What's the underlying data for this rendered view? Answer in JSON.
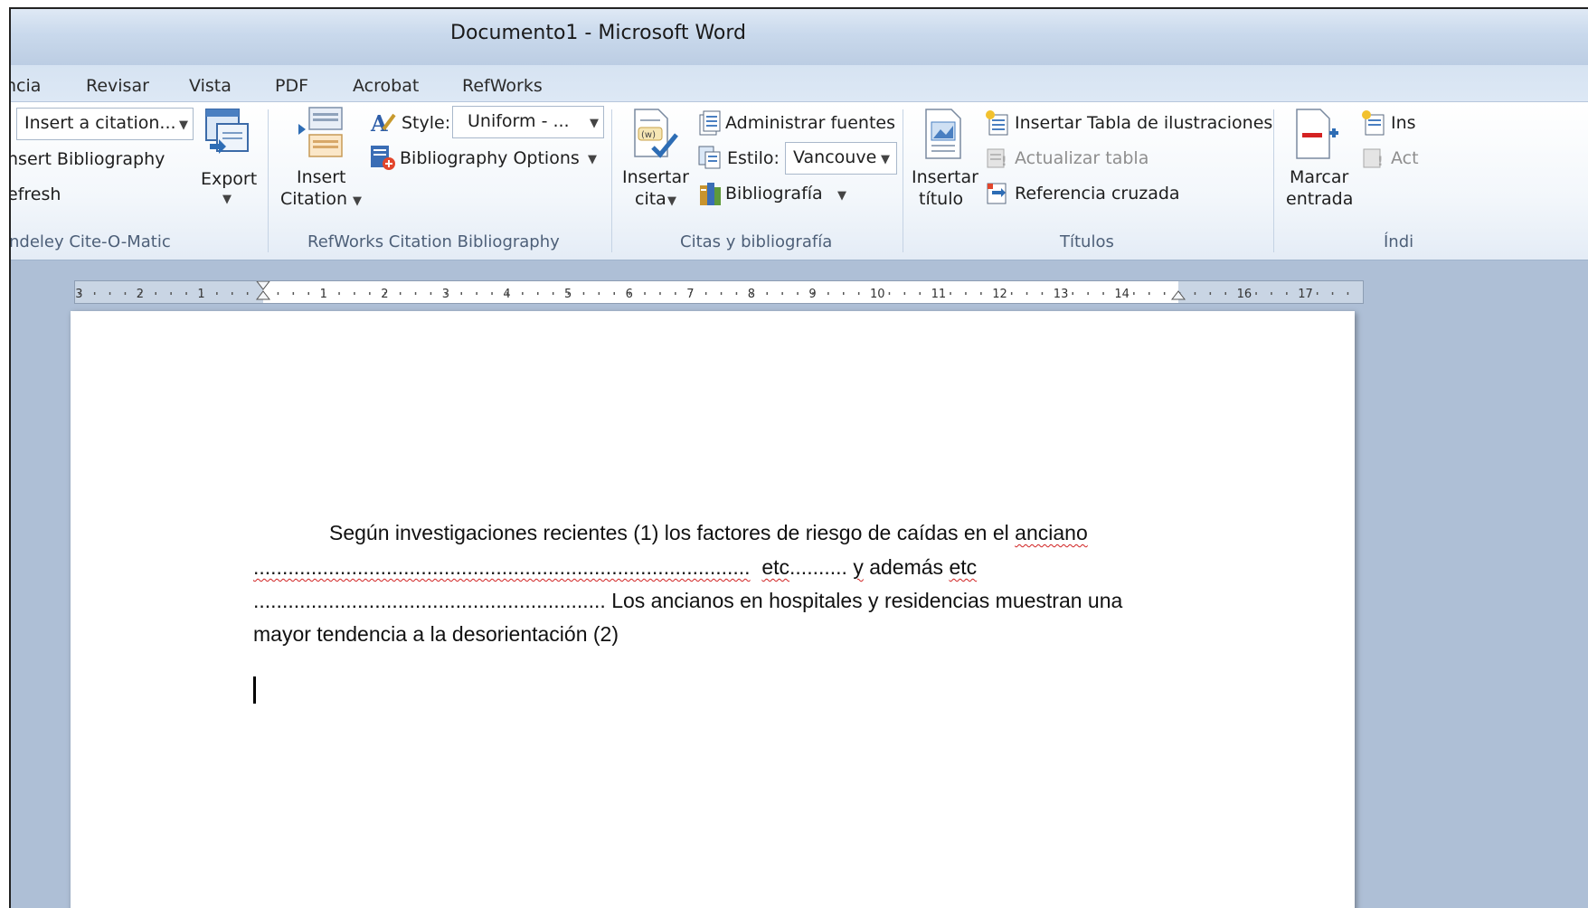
{
  "window": {
    "title": "Documento1  -  Microsoft Word"
  },
  "tabs": [
    "ncia",
    "Revisar",
    "Vista",
    "PDF",
    "Acrobat",
    "RefWorks"
  ],
  "ribbon": {
    "mendeley": {
      "citation_dropdown": "Insert a citation...",
      "insert_bibliography": "nsert Bibliography",
      "refresh": "efresh",
      "export_label": "Export",
      "group_label": "ndeley Cite-O-Matic"
    },
    "refworks": {
      "insert_label_1": "Insert",
      "insert_label_2": "Citation",
      "style_label": "Style:",
      "style_value": "Uniform - ...",
      "bibliography_options": "Bibliography Options",
      "group_label": "RefWorks Citation  Bibliography"
    },
    "citas": {
      "insertar_cita_1": "Insertar",
      "insertar_cita_2": "cita",
      "administrar_fuentes": "Administrar fuentes",
      "estilo_label": "Estilo:",
      "estilo_value": "Vancouve",
      "bibliografia": "Bibliografía",
      "group_label": "Citas y bibliografía"
    },
    "titulos": {
      "insertar_titulo_1": "Insertar",
      "insertar_titulo_2": "título",
      "insertar_tabla": "Insertar Tabla de ilustraciones",
      "actualizar_tabla": "Actualizar tabla",
      "referencia_cruzada": "Referencia cruzada",
      "group_label": "Títulos"
    },
    "indice": {
      "marcar_entrada_1": "Marcar",
      "marcar_entrada_2": "entrada",
      "insertar_partial": "Ins",
      "actualizar_partial": "Act",
      "group_label": "Índi"
    }
  },
  "ruler": {
    "left_numbers": [
      "3",
      "2",
      "1"
    ],
    "right_numbers": [
      "1",
      "2",
      "3",
      "4",
      "5",
      "6",
      "7",
      "8",
      "9",
      "10",
      "11",
      "12",
      "13",
      "14",
      "16",
      "17"
    ]
  },
  "document": {
    "line1_a": "Según investigaciones recientes (1) los factores de riesgo de caídas en el ",
    "line1_b": "anciano",
    "line2_a": "......................................................................................",
    "line2_b": "etc",
    "line2_c": ".......... ",
    "line2_d": "y",
    "line2_e": " además ",
    "line2_f": "etc",
    "line3": ".............................................................  Los ancianos en hospitales y residencias muestran una",
    "line4": "mayor tendencia a la desorientación (2)"
  },
  "colors": {
    "highlight": "#d42222",
    "frame_background": "#aebfd6"
  }
}
